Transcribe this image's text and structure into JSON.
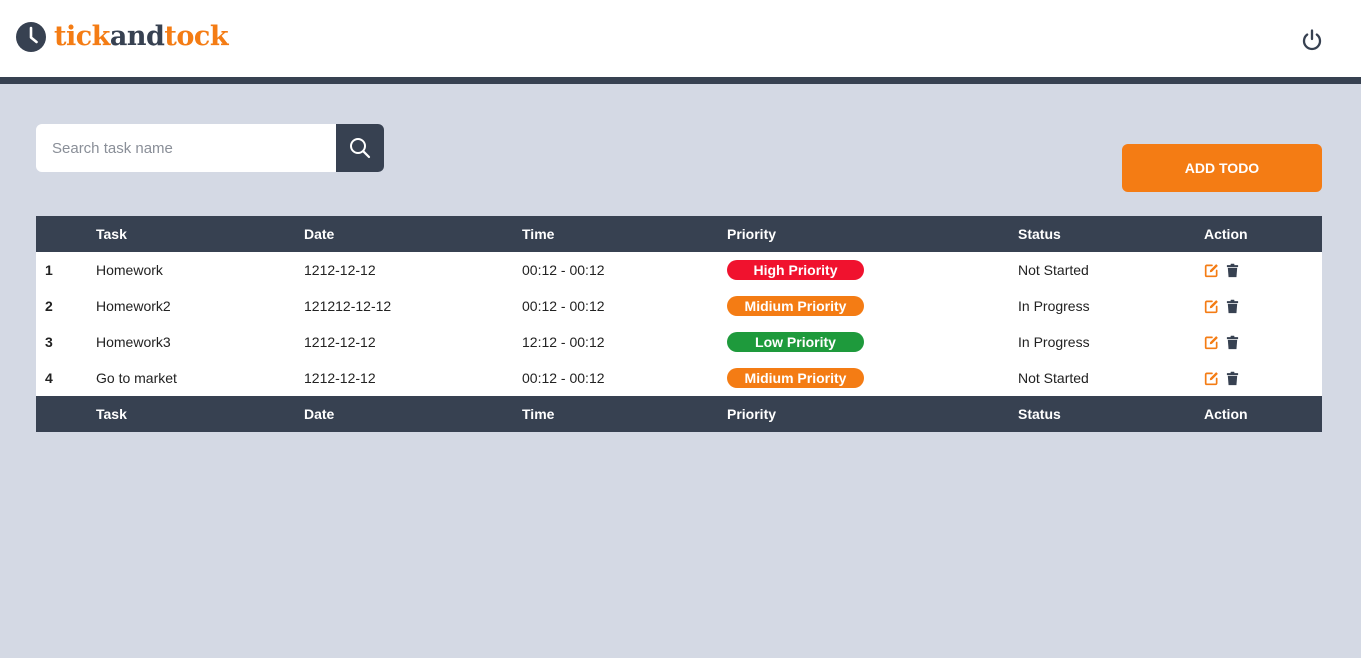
{
  "header": {
    "logo_parts": {
      "tick": "tick",
      "and": "and",
      "tock": "tock"
    },
    "logo_icon": "clock-icon",
    "power_icon": "power-icon"
  },
  "search": {
    "placeholder": "Search task name",
    "value": "",
    "icon": "search-icon"
  },
  "add_button": {
    "label": "ADD TODO"
  },
  "table": {
    "columns": [
      "",
      "Task",
      "Date",
      "Time",
      "Priority",
      "Status",
      "Action"
    ],
    "rows": [
      {
        "num": "1",
        "task": "Homework",
        "date": "1212-12-12",
        "time": "00:12 - 00:12",
        "priority": "High Priority",
        "priority_color": "#f0122e",
        "status": "Not Started"
      },
      {
        "num": "2",
        "task": "Homework2",
        "date": "121212-12-12",
        "time": "00:12 - 00:12",
        "priority": "Midium Priority",
        "priority_color": "#f47c14",
        "status": "In Progress"
      },
      {
        "num": "3",
        "task": "Homework3",
        "date": "1212-12-12",
        "time": "12:12 - 00:12",
        "priority": "Low Priority",
        "priority_color": "#1e9a3c",
        "status": "In Progress"
      },
      {
        "num": "4",
        "task": "Go to market",
        "date": "1212-12-12",
        "time": "00:12 - 00:12",
        "priority": "Midium Priority",
        "priority_color": "#f47c14",
        "status": "Not Started"
      }
    ],
    "action_icons": [
      "edit-icon",
      "trash-icon"
    ]
  },
  "colors": {
    "accent": "#f47c14",
    "dark": "#374151",
    "background": "#d4d9e4"
  }
}
